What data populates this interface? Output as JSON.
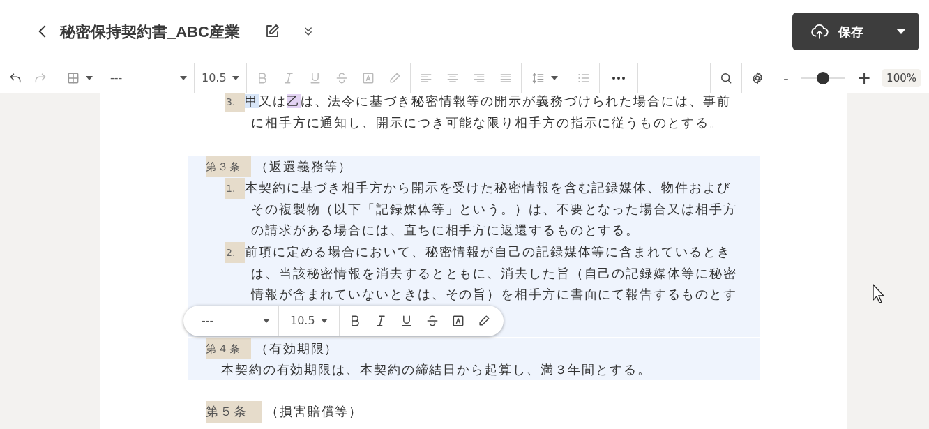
{
  "header": {
    "title": "秘密保持契約書_ABC産業",
    "save_button": "保存"
  },
  "toolbar": {
    "undo": {
      "disabled": false
    },
    "redo": {
      "disabled": true
    },
    "style_select": "---",
    "font_size": "10.5",
    "format_tools": [
      {
        "kind": "bold",
        "disabled": true
      },
      {
        "kind": "italic",
        "disabled": true
      },
      {
        "kind": "underline",
        "disabled": true
      },
      {
        "kind": "strike",
        "disabled": true
      },
      {
        "kind": "textbox",
        "disabled": true
      },
      {
        "kind": "pen",
        "disabled": true
      }
    ],
    "align_tools": [
      {
        "kind": "left"
      },
      {
        "kind": "center"
      },
      {
        "kind": "right"
      },
      {
        "kind": "justify"
      }
    ],
    "zoom": {
      "minus": "-",
      "plus": "+",
      "level": 0.5,
      "reading": "100%"
    }
  },
  "document": {
    "blocks": [
      {
        "kind": "item",
        "number": "3.",
        "selected": false,
        "runs": [
          {
            "text": "甲",
            "color": "#d8e6f8"
          },
          {
            "text": "又は"
          },
          {
            "text": "乙",
            "color": "#e3d3f3"
          },
          {
            "text": "は、法令に基づき秘密情報等の開示が義務づけられた場合には、事前"
          }
        ],
        "lines": [
          "に相手方に通知し、開示につき可能な限り相手方の指示に従うものとする。"
        ]
      },
      {
        "kind": "article",
        "selected": true,
        "label": "第３条",
        "heading": "（返還義務等）",
        "items": [
          {
            "number": "1.",
            "lines": [
              "本契約に基づき相手方から開示を受けた秘密情報を含む記録媒体、物件および",
              "その複製物（以下「記録媒体等」という。）は、不要となった場合又は相手方",
              "の請求がある場合には、直ちに相手方に返還するものとする。"
            ]
          },
          {
            "number": "2.",
            "lines": [
              "前項に定める場合において、秘密情報が自己の記録媒体等に含まれているとき",
              "は、当該秘密情報を消去するとともに、消去した旨（自己の記録媒体等に秘密",
              "情報が含まれていないときは、その旨）を相手方に書面にて報告するものとす"
            ]
          }
        ]
      },
      {
        "kind": "article",
        "selected": true,
        "label": "第４条",
        "heading": "（有効期限）",
        "paragraph": "本契約の有効期限は、本契約の締結日から起算し、満３年間とする。"
      },
      {
        "kind": "article",
        "selected": false,
        "label": "第５条",
        "heading": "（損害賠償等）"
      }
    ]
  },
  "floating_toolbar": {
    "style_select": "---",
    "font_size": "10.5",
    "tools": [
      {
        "kind": "bold"
      },
      {
        "kind": "italic"
      },
      {
        "kind": "underline"
      },
      {
        "kind": "strike"
      },
      {
        "kind": "textbox"
      },
      {
        "kind": "pen"
      }
    ]
  }
}
